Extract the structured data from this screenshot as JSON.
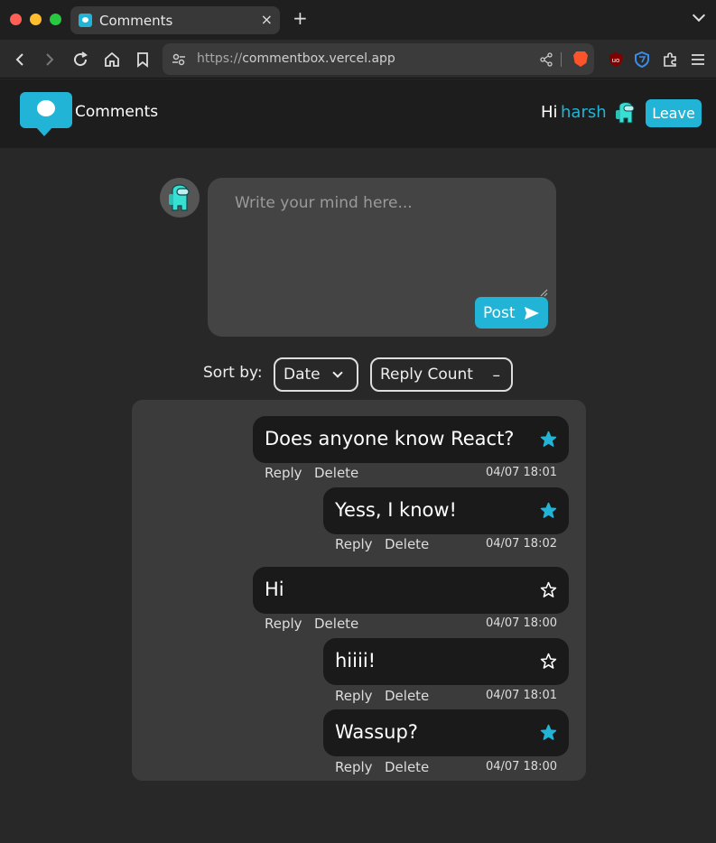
{
  "browser": {
    "tab_title": "Comments",
    "url_proto": "https://",
    "url_host": "commentbox.vercel.app"
  },
  "header": {
    "brand": "Comments",
    "greeting": "Hi",
    "username": "harsh",
    "leave_label": "Leave"
  },
  "composer": {
    "placeholder": "Write your mind here...",
    "post_label": "Post"
  },
  "sort": {
    "label": "Sort by:",
    "date_label": "Date",
    "reply_label": "Reply Count",
    "reply_indicator": "–"
  },
  "comments": [
    {
      "text": "Does anyone know React?",
      "starred": true,
      "reply_label": "Reply",
      "delete_label": "Delete",
      "timestamp": "04/07 18:01"
    },
    {
      "text": "Yess, I know!",
      "starred": true,
      "reply_label": "Reply",
      "delete_label": "Delete",
      "timestamp": "04/07 18:02"
    },
    {
      "text": "Hi",
      "starred": false,
      "reply_label": "Reply",
      "delete_label": "Delete",
      "timestamp": "04/07 18:00"
    },
    {
      "text": "hiiii!",
      "starred": false,
      "reply_label": "Reply",
      "delete_label": "Delete",
      "timestamp": "04/07 18:01"
    },
    {
      "text": "Wassup?",
      "starred": true,
      "reply_label": "Reply",
      "delete_label": "Delete",
      "timestamp": "04/07 18:00"
    }
  ],
  "colors": {
    "accent": "#21b4d6",
    "bubble": "#1a1a1a",
    "panel": "#3b3b3b",
    "background": "#282828"
  }
}
